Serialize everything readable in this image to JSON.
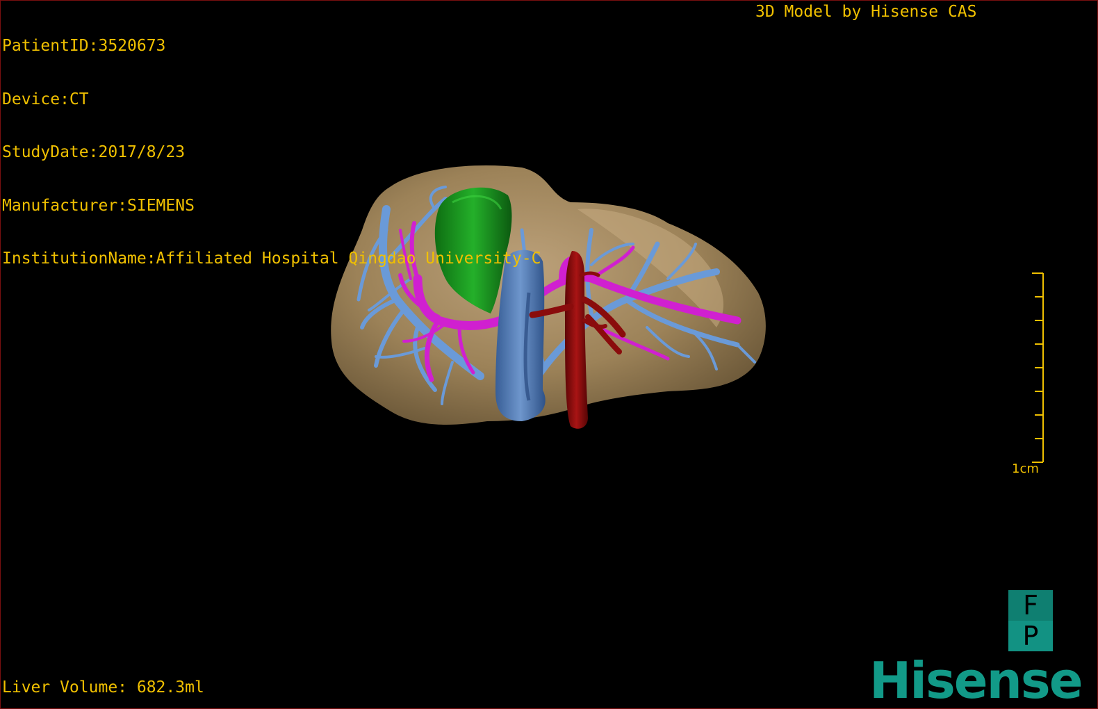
{
  "header": {
    "patient_id": "PatientID:3520673",
    "device": "Device:CT",
    "study_date": "StudyDate:2017/8/23",
    "manufacturer": "Manufacturer:SIEMENS",
    "institution": "InstitutionName:Affiliated Hospital Qingdao University-C"
  },
  "brand_title": "3D Model by Hisense CAS",
  "scale_bar": {
    "label": "1cm"
  },
  "footer": {
    "liver_volume": "Liver Volume: 682.3ml"
  },
  "orientation": {
    "top": "F",
    "bottom": "P"
  },
  "logo_text": "Hisense",
  "colors": {
    "text": "#f0c000",
    "liver": "#a08660",
    "gallbladder": "#1a9a20",
    "vena_cava": "#4a74b0",
    "portal_vein": "#d020d0",
    "hepatic_vein": "#6a9ad8",
    "artery": "#8a0c0c",
    "logo": "#129a88"
  },
  "icons": [
    "orientation-cube-icon",
    "hisense-logo"
  ]
}
